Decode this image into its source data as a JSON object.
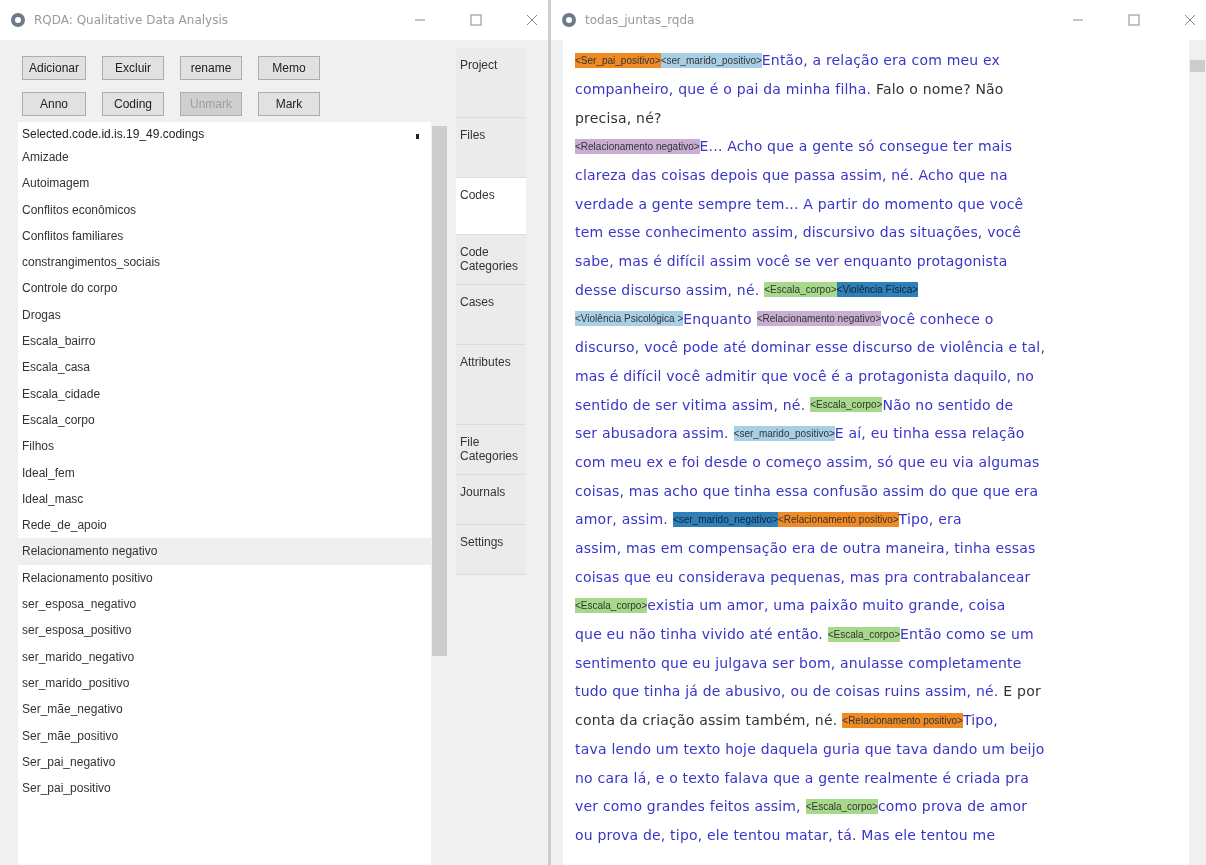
{
  "code_window": {
    "title": "RQDA: Qualitative Data Analysis",
    "buttons": [
      {
        "label": "Adicionar",
        "disabled": false
      },
      {
        "label": "Excluir",
        "disabled": false
      },
      {
        "label": "rename",
        "disabled": false
      },
      {
        "label": "Memo",
        "disabled": false
      },
      {
        "label": "Anno",
        "disabled": false
      },
      {
        "label": "Coding",
        "disabled": false
      },
      {
        "label": "Unmark",
        "disabled": true
      },
      {
        "label": "Mark",
        "disabled": false
      }
    ],
    "list_header": "Selected.code.id.is.19_49.codings",
    "codes": [
      {
        "label": "Amizade",
        "selected": false
      },
      {
        "label": "Autoimagem",
        "selected": false
      },
      {
        "label": "Conflitos econômicos",
        "selected": false
      },
      {
        "label": "Conflitos familiares",
        "selected": false
      },
      {
        "label": "constrangimentos_sociais",
        "selected": false
      },
      {
        "label": "Controle do corpo",
        "selected": false
      },
      {
        "label": "Drogas",
        "selected": false
      },
      {
        "label": "Escala_bairro",
        "selected": false
      },
      {
        "label": "Escala_casa",
        "selected": false
      },
      {
        "label": "Escala_cidade",
        "selected": false
      },
      {
        "label": "Escala_corpo",
        "selected": false
      },
      {
        "label": "Filhos",
        "selected": false
      },
      {
        "label": "Ideal_fem",
        "selected": false
      },
      {
        "label": "Ideal_masc",
        "selected": false
      },
      {
        "label": "Rede_de_apoio",
        "selected": false
      },
      {
        "label": "Relacionamento negativo",
        "selected": true
      },
      {
        "label": "Relacionamento positivo",
        "selected": false
      },
      {
        "label": "ser_esposa_negativo",
        "selected": false
      },
      {
        "label": "ser_esposa_positivo",
        "selected": false
      },
      {
        "label": "ser_marido_negativo",
        "selected": false
      },
      {
        "label": "ser_marido_positivo",
        "selected": false
      },
      {
        "label": "Ser_mãe_negativo",
        "selected": false
      },
      {
        "label": "Ser_mãe_positivo",
        "selected": false
      },
      {
        "label": "Ser_pai_negativo",
        "selected": false
      },
      {
        "label": "Ser_pai_positivo",
        "selected": false
      }
    ],
    "tabs": [
      {
        "label": "Project",
        "selected": false
      },
      {
        "label": "Files",
        "selected": false
      },
      {
        "label": "Codes",
        "selected": true
      },
      {
        "label": "Code Categories",
        "selected": false
      },
      {
        "label": "Cases",
        "selected": false
      },
      {
        "label": "Attributes",
        "selected": false
      },
      {
        "label": "File Categories",
        "selected": false
      },
      {
        "label": "Journals",
        "selected": false
      },
      {
        "label": "Settings",
        "selected": false
      }
    ]
  },
  "document_window": {
    "title": "todas_juntas_rqda",
    "lines": [
      [
        {
          "kind": "tag",
          "text": "<Ser_pai_positivo>",
          "color": "#f08a24"
        },
        {
          "kind": "tag",
          "text": "<ser_marido_positivo>",
          "color": "#a9cfe6"
        },
        {
          "kind": "text",
          "text": "Então, a relação era com meu ex",
          "coded": true
        }
      ],
      [
        {
          "kind": "text",
          "text": "companheiro, que é o pai da minha filha.",
          "coded": true
        },
        {
          "kind": "text",
          "text": "Falo o nome? Não",
          "coded": false
        }
      ],
      [
        {
          "kind": "text",
          "text": "precisa, né?",
          "coded": false
        }
      ],
      [
        {
          "kind": "tag",
          "text": "<Relacionamento negativo>",
          "color": "#c9aed3"
        },
        {
          "kind": "text",
          "text": "E... Acho que a gente só consegue ter mais",
          "coded": true
        }
      ],
      [
        {
          "kind": "text",
          "text": "clareza das coisas depois que passa assim, né. Acho que na",
          "coded": true
        }
      ],
      [
        {
          "kind": "text",
          "text": "verdade a gente sempre tem... A partir do momento que você",
          "coded": true
        }
      ],
      [
        {
          "kind": "text",
          "text": "tem esse conhecimento assim, discursivo das situações, você",
          "coded": true
        }
      ],
      [
        {
          "kind": "text",
          "text": "sabe, mas é difícil assim você se ver enquanto protagonista",
          "coded": true
        }
      ],
      [
        {
          "kind": "text",
          "text": "desse discurso assim, né.",
          "coded": true
        },
        {
          "kind": "tag",
          "text": "<Escala_corpo>",
          "color": "#a6d98a"
        },
        {
          "kind": "tag",
          "text": "<Violência Física>",
          "color": "#2f7fb8"
        }
      ],
      [
        {
          "kind": "tag",
          "text": "<Violência Psicológica >",
          "color": "#a9cfe6"
        },
        {
          "kind": "text",
          "text": "Enquanto",
          "coded": true
        },
        {
          "kind": "tag",
          "text": "<Relacionamento negativo>",
          "color": "#c9aed3"
        },
        {
          "kind": "text",
          "text": "você conhece o",
          "coded": true
        }
      ],
      [
        {
          "kind": "text",
          "text": "discurso, você pode até dominar esse discurso de violência e tal,",
          "coded": true
        }
      ],
      [
        {
          "kind": "text",
          "text": "mas é difícil você admitir que você é a protagonista daquilo, no",
          "coded": true
        }
      ],
      [
        {
          "kind": "text",
          "text": "sentido de ser vitima assim, né.",
          "coded": true
        },
        {
          "kind": "tag",
          "text": "<Escala_corpo>",
          "color": "#a6d98a"
        },
        {
          "kind": "text",
          "text": "Não no sentido de",
          "coded": true
        }
      ],
      [
        {
          "kind": "text",
          "text": "ser abusadora assim.",
          "coded": true
        },
        {
          "kind": "tag",
          "text": "<ser_marido_positivo>",
          "color": "#a9cfe6"
        },
        {
          "kind": "text",
          "text": "E aí, eu tinha essa relação",
          "coded": true
        }
      ],
      [
        {
          "kind": "text",
          "text": "com meu ex e foi desde o começo assim, só que eu via algumas",
          "coded": true
        }
      ],
      [
        {
          "kind": "text",
          "text": "coisas, mas acho que tinha essa confusão assim do que que era",
          "coded": true
        }
      ],
      [
        {
          "kind": "text",
          "text": "amor, assim.",
          "coded": true
        },
        {
          "kind": "tag",
          "text": "<ser_marido_negativo>",
          "color": "#2f7fb8"
        },
        {
          "kind": "tag",
          "text": "<Relacionamento positivo>",
          "color": "#f08a24"
        },
        {
          "kind": "text",
          "text": "Tipo, era",
          "coded": true
        }
      ],
      [
        {
          "kind": "text",
          "text": "assim, mas em compensação era de outra maneira, tinha essas",
          "coded": true
        }
      ],
      [
        {
          "kind": "text",
          "text": "coisas que eu considerava pequenas, mas pra contrabalancear",
          "coded": true
        }
      ],
      [
        {
          "kind": "tag",
          "text": "<Escala_corpo>",
          "color": "#a6d98a"
        },
        {
          "kind": "text",
          "text": "existia um amor, uma paixão muito grande, coisa",
          "coded": true
        }
      ],
      [
        {
          "kind": "text",
          "text": "que eu não tinha vivido até então.",
          "coded": true
        },
        {
          "kind": "tag",
          "text": "<Escala_corpo>",
          "color": "#a6d98a"
        },
        {
          "kind": "text",
          "text": "Então como se um",
          "coded": true
        }
      ],
      [
        {
          "kind": "text",
          "text": "sentimento que eu julgava ser bom, anulasse completamente",
          "coded": true
        }
      ],
      [
        {
          "kind": "text",
          "text": "tudo que tinha já de abusivo, ou de coisas ruins assim, né.",
          "coded": true
        },
        {
          "kind": "text",
          "text": "E por",
          "coded": false
        }
      ],
      [
        {
          "kind": "text",
          "text": "conta da criação assim também, né.",
          "coded": false
        },
        {
          "kind": "tag",
          "text": "<Relacionamento positivo>",
          "color": "#f08a24"
        },
        {
          "kind": "text",
          "text": "Tipo,",
          "coded": true
        }
      ],
      [
        {
          "kind": "text",
          "text": "tava lendo um texto hoje daquela guria que tava dando um beijo",
          "coded": true
        }
      ],
      [
        {
          "kind": "text",
          "text": "no cara lá, e o texto falava que a gente realmente é criada pra",
          "coded": true
        }
      ],
      [
        {
          "kind": "text",
          "text": "ver como grandes feitos assim,",
          "coded": true
        },
        {
          "kind": "tag",
          "text": "<Escala_corpo>",
          "color": "#a6d98a"
        },
        {
          "kind": "text",
          "text": "como prova de amor",
          "coded": true
        }
      ],
      [
        {
          "kind": "text",
          "text": "ou prova de, tipo, ele tentou matar, tá. Mas ele tentou me",
          "coded": true
        }
      ]
    ]
  }
}
